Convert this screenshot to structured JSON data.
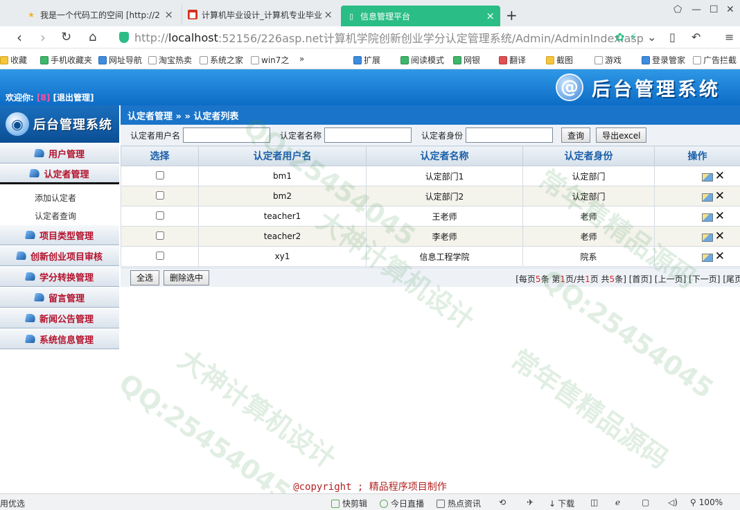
{
  "browser": {
    "tabs": [
      {
        "label": "我是一个代码工的空间 [http://2"
      },
      {
        "label": "计算机毕业设计_计算机专业毕业"
      },
      {
        "label": "信息管理平台"
      }
    ],
    "url_prefix": "http://",
    "url_host": "localhost",
    "url_rest": ":52156/226asp.net计算机学院创新创业学分认定管理系统/Admin/AdminIndex.aspx",
    "bookmarks": [
      "收藏",
      "手机收藏夹",
      "网址导航",
      "淘宝热卖",
      "系统之家",
      "win7之"
    ],
    "toolbar_right": [
      "扩展",
      "阅读模式",
      "网银",
      "翻译",
      "截图",
      "游戏",
      "登录管家",
      "广告拦截"
    ]
  },
  "header": {
    "welcome": "欢迎你:",
    "username": "[8]",
    "logout": "[退出管理]",
    "system_title": "后台管理系统"
  },
  "sidebar": {
    "logo_text": "后台管理系统",
    "menus": [
      {
        "label": "用户管理"
      },
      {
        "label": "认定者管理"
      },
      {
        "label": "项目类型管理"
      },
      {
        "label": "创新创业项目审核"
      },
      {
        "label": "学分转换管理"
      },
      {
        "label": "留言管理"
      },
      {
        "label": "新闻公告管理"
      },
      {
        "label": "系统信息管理"
      }
    ],
    "subitems": [
      "添加认定者",
      "认定者查询"
    ]
  },
  "main": {
    "breadcrumb": "认定者管理 » » 认定者列表",
    "search": {
      "username_label": "认定者用户名",
      "name_label": "认定者名称",
      "identity_label": "认定者身份",
      "username_value": "",
      "name_value": "",
      "identity_value": "",
      "query_button": "查询",
      "export_button": "导出excel"
    },
    "table": {
      "headers": [
        "选择",
        "认定者用户名",
        "认定者名称",
        "认定者身份",
        "操作"
      ],
      "rows": [
        {
          "username": "bm1",
          "name": "认定部门1",
          "identity": "认定部门"
        },
        {
          "username": "bm2",
          "name": "认定部门2",
          "identity": "认定部门"
        },
        {
          "username": "teacher1",
          "name": "王老师",
          "identity": "老师"
        },
        {
          "username": "teacher2",
          "name": "李老师",
          "identity": "老师"
        },
        {
          "username": "xy1",
          "name": "信息工程学院",
          "identity": "院系"
        }
      ]
    },
    "footer": {
      "select_all": "全选",
      "delete_selected": "删除选中",
      "pager": {
        "p1": "[每页",
        "per_page": "5",
        "p2": "条 第",
        "current": "1",
        "p3": "页/共",
        "total_pages": "1",
        "p4": "页 共",
        "total": "5",
        "p5": "条]",
        "first": "[首页]",
        "prev": "[上一页]",
        "next": "[下一页]",
        "last": "[尾页"
      }
    }
  },
  "copyright": "@copyright ; 精品程序项目制作",
  "status": {
    "left": "用优选",
    "items": [
      "快剪辑",
      "今日直播",
      "热点资讯",
      "下载",
      "100%"
    ]
  },
  "watermarks": [
    "QQ:25454045",
    "大神计算机设计",
    "常年售精品源码"
  ]
}
